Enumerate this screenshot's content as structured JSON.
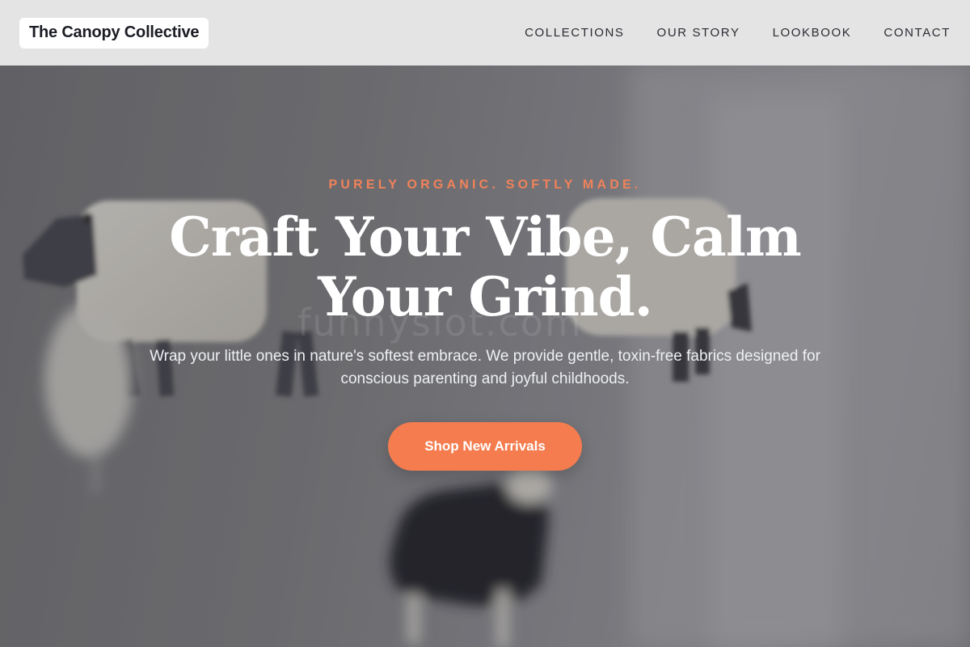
{
  "header": {
    "brand": "The Canopy Collective",
    "nav": [
      {
        "label": "COLLECTIONS"
      },
      {
        "label": "OUR STORY"
      },
      {
        "label": "LOOKBOOK"
      },
      {
        "label": "CONTACT"
      }
    ]
  },
  "hero": {
    "eyebrow": "PURELY ORGANIC. SOFTLY MADE.",
    "headline": "Craft Your Vibe, Calm Your Grind.",
    "subtext": "Wrap your little ones in nature's softest embrace. We provide gentle, toxin-free fabrics designed for conscious parenting and joyful childhoods.",
    "cta_label": "Shop New Arrivals",
    "watermark": "funnyslot.com",
    "image_subject": "felt sheep mobile"
  },
  "colors": {
    "accent": "#f47c4f",
    "eyebrow": "#f0825a",
    "header_bg": "#e4e4e4",
    "brand_text": "#1b1d24"
  }
}
